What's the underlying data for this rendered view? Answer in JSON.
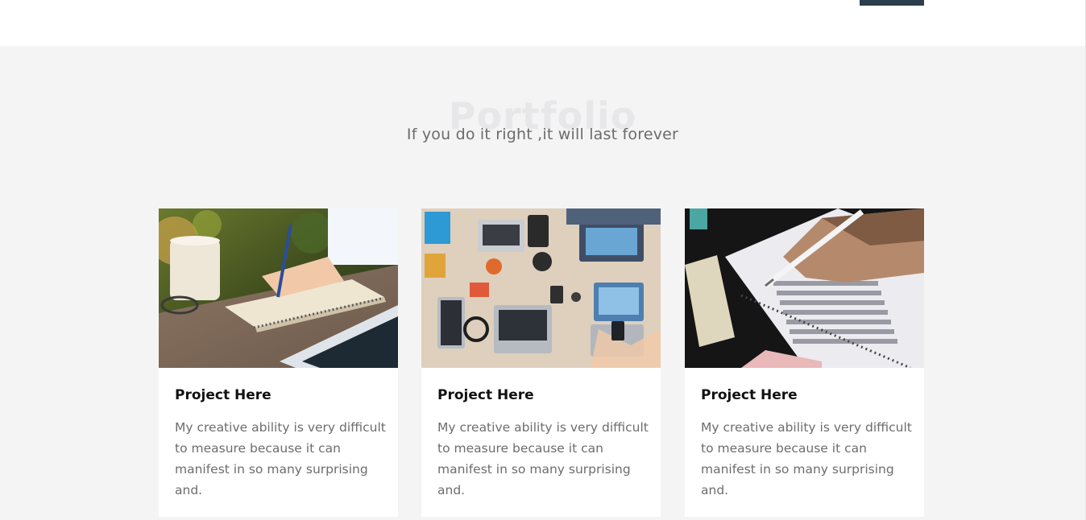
{
  "header": {
    "button_color": "#2c3e4c"
  },
  "portfolio": {
    "watermark": "Portfolio",
    "subtitle": "If you do it right ,it will last forever",
    "projects": [
      {
        "image": "writing-notebook-photo",
        "title": "Project Here",
        "description": "My creative ability is very difficult to measure because it can manifest in so many surprising and."
      },
      {
        "image": "team-laptops-desk-photo",
        "title": "Project Here",
        "description": "My creative ability is very difficult to measure because it can manifest in so many surprising and."
      },
      {
        "image": "answer-sheet-pencil-photo",
        "title": "Project Here",
        "description": "My creative ability is very difficult to measure because it can manifest in so many surprising and."
      }
    ]
  }
}
